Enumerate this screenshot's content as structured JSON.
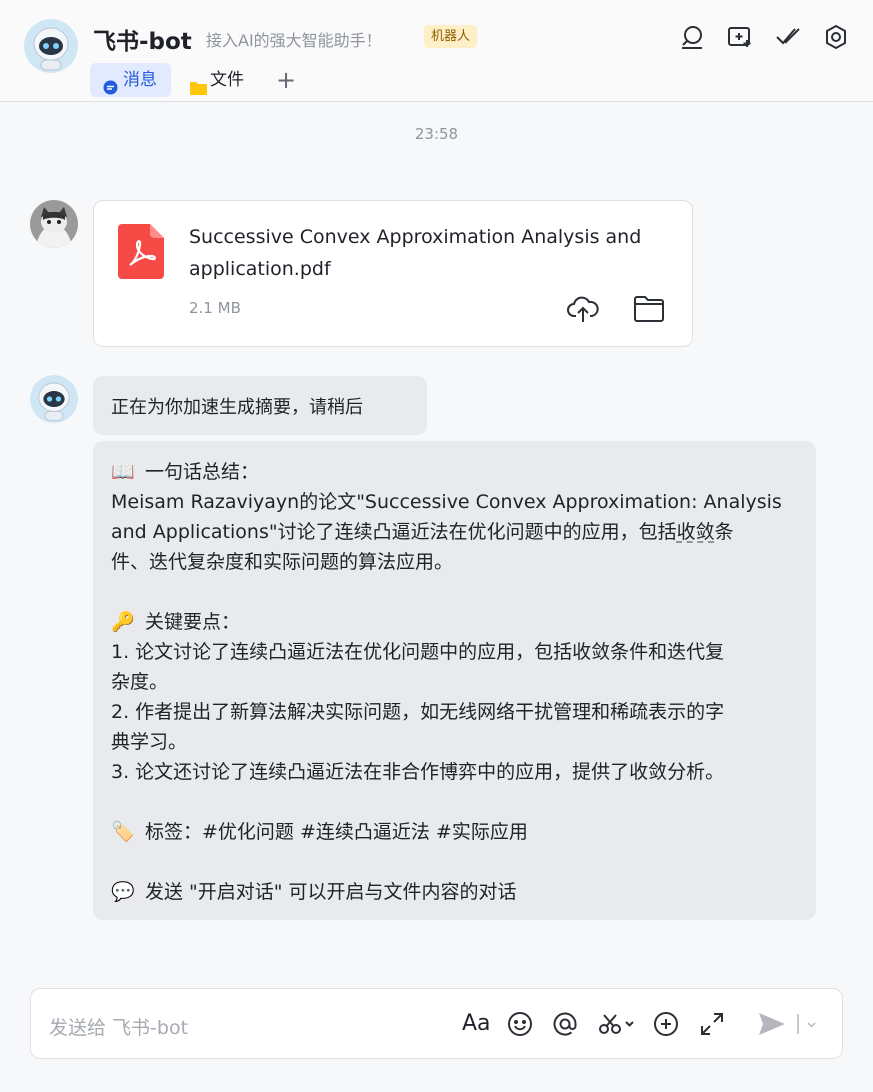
{
  "header": {
    "bot_name": "飞书-bot",
    "subtitle": "接入AI的强大智能助手！",
    "badge": "机器人",
    "icons": [
      "search-icon",
      "new-chat-icon",
      "done-icon",
      "settings-icon"
    ],
    "tabs": [
      {
        "label": "消息",
        "icon": "message-icon",
        "active": true
      },
      {
        "label": "文件",
        "icon": "folder-icon",
        "active": false
      }
    ],
    "add_tab": "+"
  },
  "chat": {
    "timestamp": "23:58",
    "file_message": {
      "file_name_line1": "Successive Convex Approximation Analysis and",
      "file_name_line2": "application.pdf",
      "file_size": "2.1 MB",
      "icons": [
        "pdf-icon",
        "cloud-upload-icon",
        "folder-icon"
      ]
    },
    "bot_status": "正在为你加速生成摘要，请稍后",
    "summary": {
      "summary_heading": "一句话总结：",
      "summary_line1": "Meisam Razaviyayn的论文\"Successive Convex Approximation: Analysis",
      "summary_line2a": "and Applications\"讨论了连续凸逼近法在优化问题中的应用，包括",
      "summary_line2b": "收敛",
      "summary_line2c": "条",
      "summary_line3": "件、迭代复杂度和实际问题的算法应用。",
      "points_heading": "关键要点：",
      "point1a": "1. 论文讨论了连续凸逼近法在优化问题中的应用，包括收敛条件和迭代复",
      "point1b": "杂度。",
      "point2a": "2. 作者提出了新算法解决实际问题，如无线网络干扰管理和稀疏表示的字",
      "point2b": "典学习。",
      "point3": "3. 论文还讨论了连续凸逼近法在非合作博弈中的应用，提供了收敛分析。",
      "tags": "标签：#优化问题 #连续凸逼近法 #实际应用",
      "dialog_hint": "发送 \"开启对话\" 可以开启与文件内容的对话",
      "emoji": {
        "book": "📖",
        "key": "🔑",
        "tag": "🏷️",
        "bubble": "💬"
      }
    }
  },
  "composer": {
    "placeholder": "发送给 飞书-bot",
    "text_format_label": "Aa",
    "icons": [
      "text-format-icon",
      "emoji-icon",
      "mention-icon",
      "screenshot-icon",
      "add-icon",
      "expand-icon",
      "send-icon"
    ]
  },
  "colors": {
    "accent": "#245bdb",
    "pdf_red": "#f54a45",
    "folder_yellow": "#ffc60a",
    "bubble": "#e8eaed"
  }
}
